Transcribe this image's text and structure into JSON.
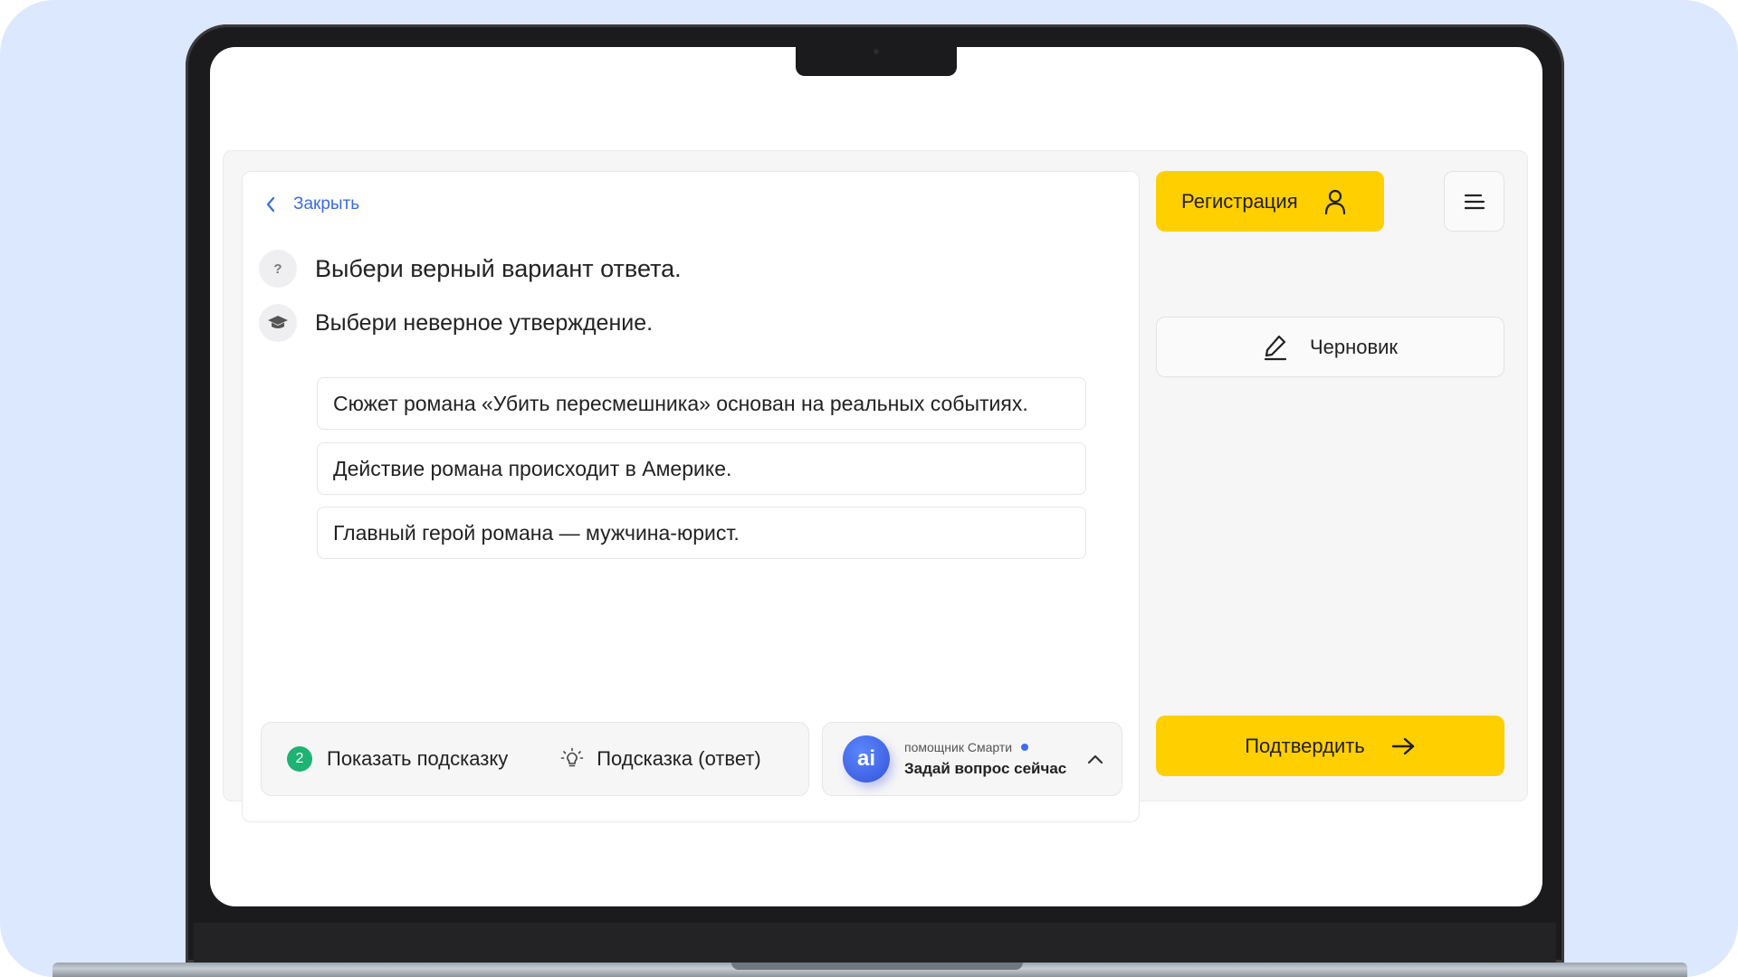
{
  "task": {
    "close_label": "Закрыть",
    "question_icon_glyph": "?",
    "instruction": "Выбери верный вариант ответа.",
    "subinstruction": "Выбери неверное утверждение.",
    "options": [
      "Сюжет романа «Убить пересмешника» основан на реальных событиях.",
      "Действие романа происходит в Америке.",
      "Главный герой романа — мужчина-юрист."
    ]
  },
  "hints": {
    "count": "2",
    "show_hint_label": "Показать подсказку",
    "answer_hint_label": "Подсказка (ответ)"
  },
  "assistant": {
    "avatar_text": "ai",
    "caption": "помощник Смарти",
    "prompt": "Задай вопрос сейчас"
  },
  "sidebar": {
    "register_label": "Регистрация",
    "draft_label": "Черновик",
    "confirm_label": "Подтвердить"
  },
  "icons": {
    "back": "chevron-left-icon",
    "question": "question-icon",
    "graduation": "graduation-cap-icon",
    "bulb": "lightbulb-icon",
    "expand": "chevron-up-icon",
    "user": "user-icon",
    "menu": "menu-icon",
    "pencil": "pencil-icon",
    "arrow": "arrow-right-icon"
  },
  "colors": {
    "accent_yellow": "#ffcf00",
    "link_blue": "#3a6bdf",
    "badge_green": "#1eb273",
    "backdrop": "#dce8fd"
  }
}
